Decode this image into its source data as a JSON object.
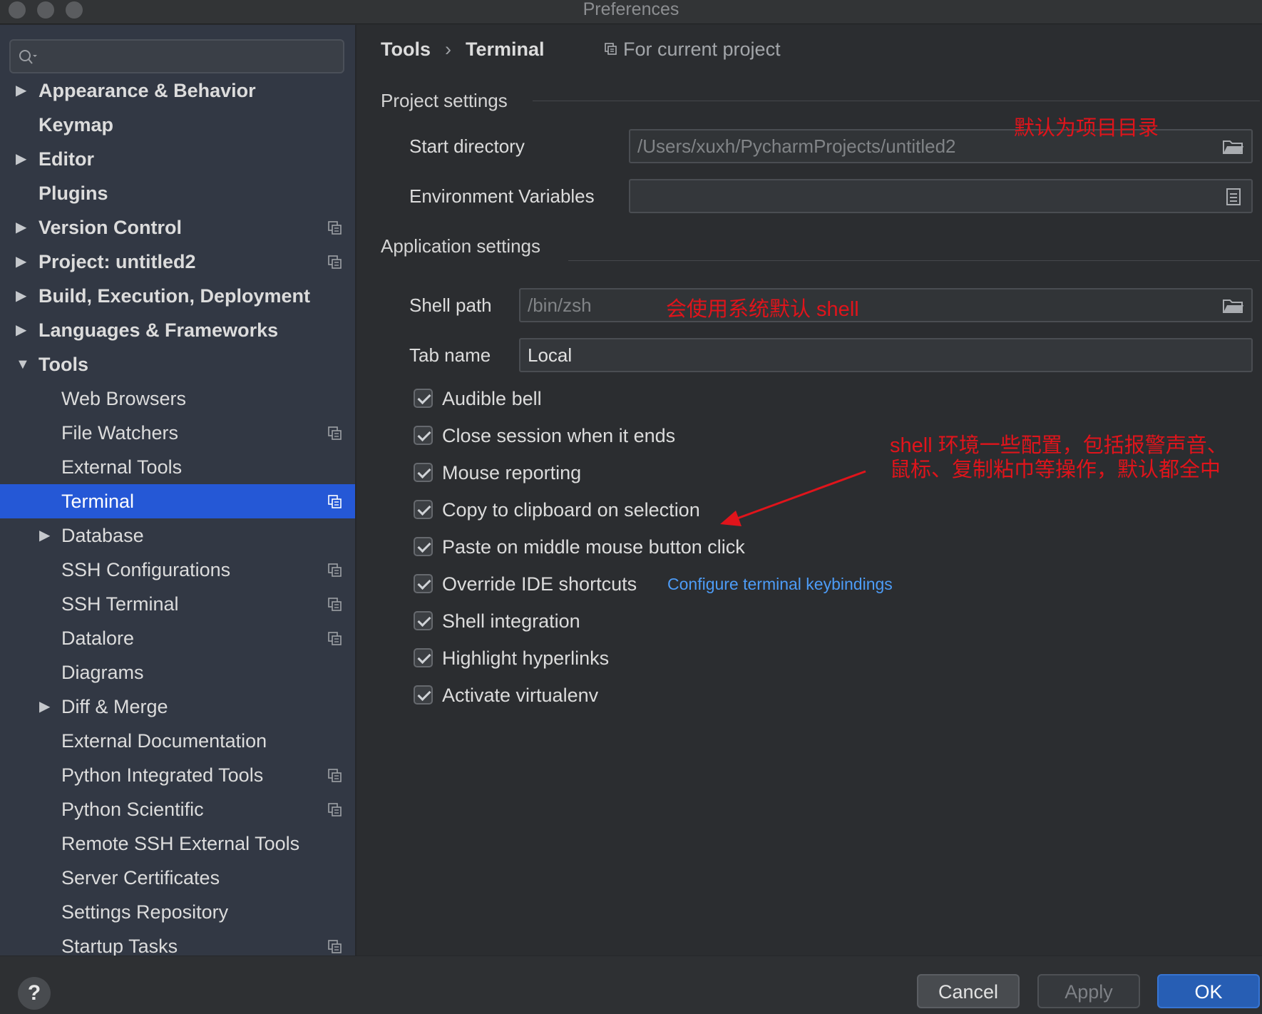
{
  "window": {
    "title": "Preferences"
  },
  "search": {
    "placeholder": ""
  },
  "sidebar": {
    "items": [
      {
        "label": "Appearance & Behavior",
        "arrow": "▶"
      },
      {
        "label": "Keymap",
        "arrow": ""
      },
      {
        "label": "Editor",
        "arrow": "▶"
      },
      {
        "label": "Plugins",
        "arrow": ""
      },
      {
        "label": "Version Control",
        "arrow": "▶"
      },
      {
        "label": "Project: untitled2",
        "arrow": "▶"
      },
      {
        "label": "Build, Execution, Deployment",
        "arrow": "▶"
      },
      {
        "label": "Languages & Frameworks",
        "arrow": "▶"
      },
      {
        "label": "Tools",
        "arrow": "▼"
      },
      {
        "label": "Web Browsers",
        "arrow": ""
      },
      {
        "label": "File Watchers",
        "arrow": ""
      },
      {
        "label": "External Tools",
        "arrow": ""
      },
      {
        "label": "Terminal",
        "arrow": ""
      },
      {
        "label": "Database",
        "arrow": "▶"
      },
      {
        "label": "SSH Configurations",
        "arrow": ""
      },
      {
        "label": "SSH Terminal",
        "arrow": ""
      },
      {
        "label": "Datalore",
        "arrow": ""
      },
      {
        "label": "Diagrams",
        "arrow": ""
      },
      {
        "label": "Diff & Merge",
        "arrow": "▶"
      },
      {
        "label": "External Documentation",
        "arrow": ""
      },
      {
        "label": "Python Integrated Tools",
        "arrow": ""
      },
      {
        "label": "Python Scientific",
        "arrow": ""
      },
      {
        "label": "Remote SSH External Tools",
        "arrow": ""
      },
      {
        "label": "Server Certificates",
        "arrow": ""
      },
      {
        "label": "Settings Repository",
        "arrow": ""
      },
      {
        "label": "Startup Tasks",
        "arrow": ""
      }
    ]
  },
  "breadcrumb": {
    "parent": "Tools",
    "separator": "›",
    "current": "Terminal",
    "scope": "For current project"
  },
  "project_settings": {
    "title": "Project settings",
    "start_directory_label": "Start directory",
    "start_directory_value": "/Users/xuxh/PycharmProjects/untitled2",
    "env_vars_label": "Environment Variables",
    "env_vars_value": ""
  },
  "app_settings": {
    "title": "Application settings",
    "shell_path_label": "Shell path",
    "shell_path_value": "/bin/zsh",
    "tab_name_label": "Tab name",
    "tab_name_value": "Local"
  },
  "checkboxes": [
    {
      "label": "Audible bell",
      "checked": true
    },
    {
      "label": "Close session when it ends",
      "checked": true
    },
    {
      "label": "Mouse reporting",
      "checked": true
    },
    {
      "label": "Copy to clipboard on selection",
      "checked": true
    },
    {
      "label": "Paste on middle mouse button click",
      "checked": true
    },
    {
      "label": "Override IDE shortcuts",
      "checked": true
    },
    {
      "label": "Shell integration",
      "checked": true
    },
    {
      "label": "Highlight hyperlinks",
      "checked": true
    },
    {
      "label": "Activate virtualenv",
      "checked": true
    }
  ],
  "keybindings_link": "Configure terminal keybindings",
  "annotations": {
    "start_dir_note": "默认为项目目录",
    "shell_note": "会使用系统默认 shell",
    "options_note_line1": "shell 环境一些配置，包括报警声音、",
    "options_note_line2": "鼠标、复制粘巾等操作，默认都全中"
  },
  "footer": {
    "help": "?",
    "cancel": "Cancel",
    "apply": "Apply",
    "ok": "OK"
  },
  "colors": {
    "selection": "#2558d6",
    "annotation": "#e0141b",
    "link": "#4d9cf7",
    "ok_button": "#275eb4"
  }
}
